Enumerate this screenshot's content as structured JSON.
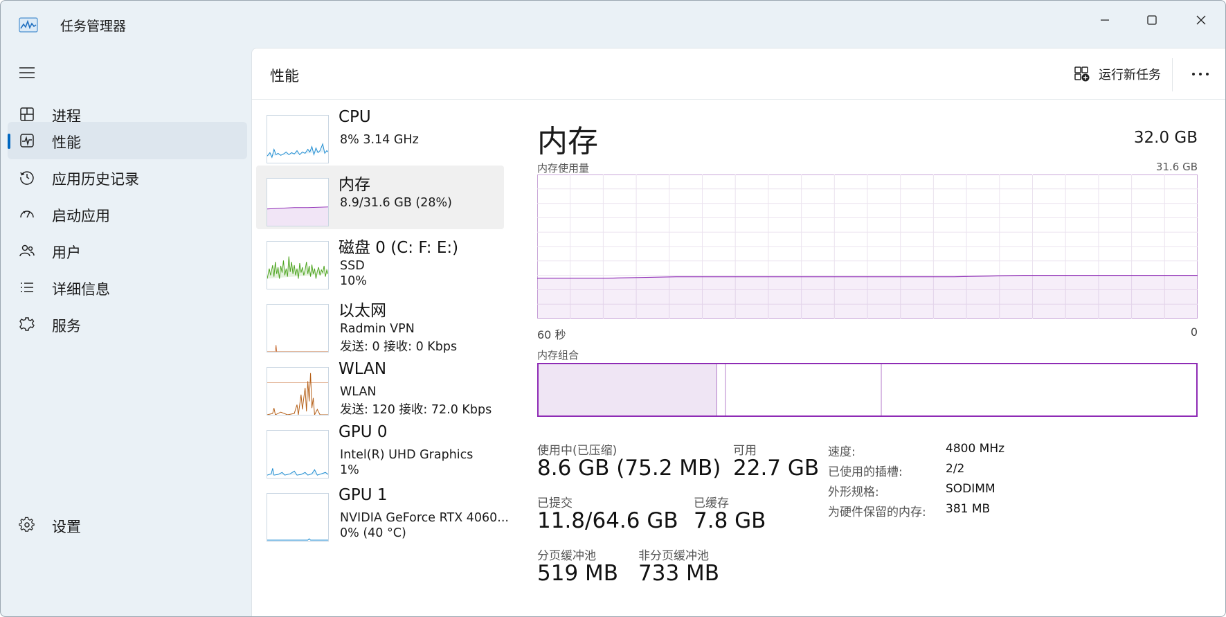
{
  "window": {
    "title": "任务管理器",
    "icon": "task-manager-icon"
  },
  "sidebar": {
    "items": [
      {
        "label": "进程",
        "icon": "processes-icon"
      },
      {
        "label": "性能",
        "icon": "performance-icon",
        "active": true
      },
      {
        "label": "应用历史记录",
        "icon": "history-icon"
      },
      {
        "label": "启动应用",
        "icon": "startup-icon"
      },
      {
        "label": "用户",
        "icon": "users-icon"
      },
      {
        "label": "详细信息",
        "icon": "details-icon"
      },
      {
        "label": "服务",
        "icon": "services-icon"
      }
    ],
    "settings_label": "设置"
  },
  "header": {
    "title": "性能",
    "run_task_label": "运行新任务"
  },
  "devices": [
    {
      "name": "CPU",
      "lines": [
        "8%  3.14 GHz"
      ],
      "color": "#1a8ad0"
    },
    {
      "name": "内存",
      "lines": [
        "8.9/31.6 GB (28%)"
      ],
      "color": "#8e2bb5",
      "selected": true
    },
    {
      "name": "磁盘 0 (C: F: E:)",
      "lines": [
        "SSD",
        "10%"
      ],
      "color": "#4ca41e"
    },
    {
      "name": "以太网",
      "lines": [
        "Radmin VPN",
        "发送: 0  接收: 0 Kbps"
      ],
      "color": "#c8703a"
    },
    {
      "name": "WLAN",
      "lines": [
        "WLAN",
        "发送: 120  接收: 72.0 Kbps"
      ],
      "color": "#b45d14"
    },
    {
      "name": "GPU 0",
      "lines": [
        "Intel(R) UHD Graphics",
        "1%"
      ],
      "color": "#1a8ad0"
    },
    {
      "name": "GPU 1",
      "lines": [
        "NVIDIA GeForce RTX 4060...",
        "0% (40 °C)"
      ],
      "color": "#1a8ad0"
    }
  ],
  "detail": {
    "title": "内存",
    "total": "32.0 GB",
    "chart_label": "内存使用量",
    "chart_max": "31.6 GB",
    "axis_left": "60 秒",
    "axis_right": "0",
    "composition_label": "内存组合",
    "usage_fraction_history": [
      0.28,
      0.28,
      0.28,
      0.285,
      0.29,
      0.29,
      0.29,
      0.29,
      0.29,
      0.29,
      0.29,
      0.29,
      0.29,
      0.295,
      0.3,
      0.3,
      0.3,
      0.3,
      0.3,
      0.3
    ],
    "composition": {
      "in_use_fraction": 0.272,
      "modified_fraction": 0.013,
      "standby_fraction": 0.236
    },
    "stats": {
      "in_use_label": "使用中(已压缩)",
      "in_use_value": "8.6 GB (75.2 MB)",
      "available_label": "可用",
      "available_value": "22.7 GB",
      "committed_label": "已提交",
      "committed_value": "11.8/64.6 GB",
      "cached_label": "已缓存",
      "cached_value": "7.8 GB",
      "paged_label": "分页缓冲池",
      "paged_value": "519 MB",
      "nonpaged_label": "非分页缓冲池",
      "nonpaged_value": "733 MB"
    },
    "specs": [
      {
        "key": "速度:",
        "value": "4800 MHz"
      },
      {
        "key": "已使用的插槽:",
        "value": "2/2"
      },
      {
        "key": "外形规格:",
        "value": "SODIMM"
      },
      {
        "key": "为硬件保留的内存:",
        "value": "381 MB"
      }
    ]
  }
}
